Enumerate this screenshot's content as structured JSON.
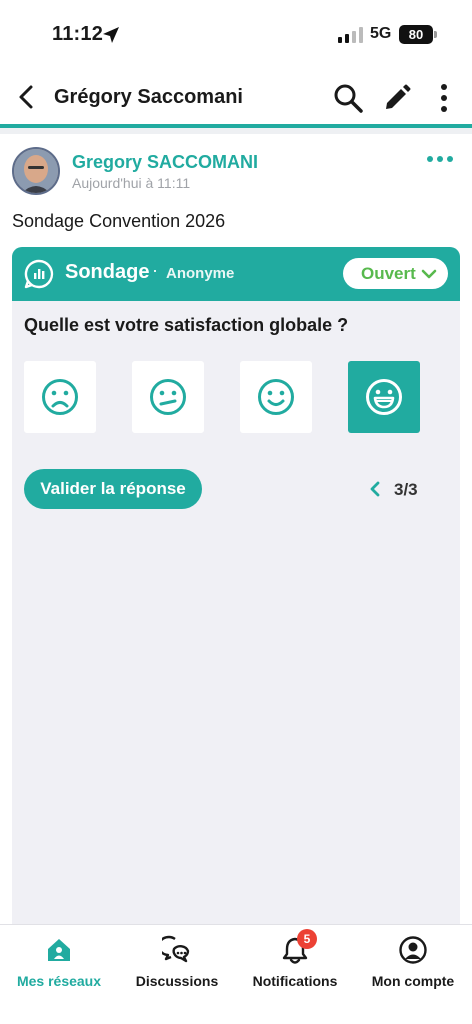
{
  "status_bar": {
    "time": "11:12",
    "network": "5G",
    "battery": "80"
  },
  "header": {
    "title": "Grégory Saccomani",
    "icons": [
      "back-arrow-icon",
      "search-icon",
      "pencil-icon",
      "more-vertical-icon"
    ]
  },
  "post": {
    "author_name": "Gregory SACCOMANI",
    "timestamp": "Aujourd'hui à 11:11",
    "text": "Sondage Convention 2026"
  },
  "poll": {
    "title": "Sondage",
    "separator": "·",
    "mode": "Anonyme",
    "status": "Ouvert",
    "question": "Quelle est votre satisfaction globale ?",
    "options": [
      {
        "icon": "sad-face-icon",
        "selected": false
      },
      {
        "icon": "neutral-face-icon",
        "selected": false
      },
      {
        "icon": "smile-face-icon",
        "selected": false
      },
      {
        "icon": "grin-face-icon",
        "selected": true
      }
    ],
    "submit_label": "Valider la réponse",
    "pager": "3/3"
  },
  "nav": {
    "items": [
      {
        "label": "Mes réseaux",
        "icon": "home-icon",
        "active": true
      },
      {
        "label": "Discussions",
        "icon": "chat-icon",
        "active": false
      },
      {
        "label": "Notifications",
        "icon": "bell-icon",
        "active": false,
        "badge": "5"
      },
      {
        "label": "Mon compte",
        "icon": "user-circle-icon",
        "active": false
      }
    ]
  },
  "colors": {
    "accent": "#21aba0",
    "status_green": "#58b94d",
    "badge_red": "#ec4134",
    "card_bg": "#f0f0f5"
  }
}
